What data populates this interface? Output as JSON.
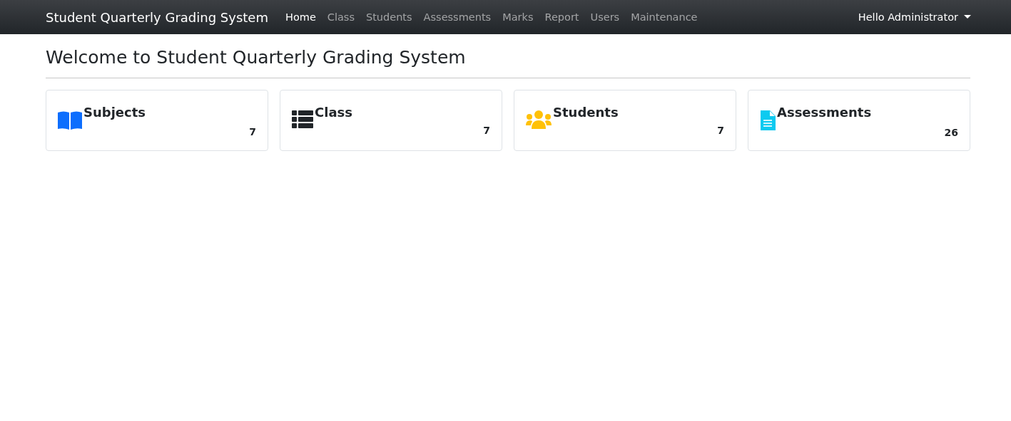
{
  "navbar": {
    "brand": "Student Quarterly Grading System",
    "items": [
      {
        "label": "Home",
        "selected": true
      },
      {
        "label": "Class",
        "selected": false
      },
      {
        "label": "Students",
        "selected": false
      },
      {
        "label": "Assessments",
        "selected": false
      },
      {
        "label": "Marks",
        "selected": false
      },
      {
        "label": "Report",
        "selected": false
      },
      {
        "label": "Users",
        "selected": false
      },
      {
        "label": "Maintenance",
        "selected": false
      }
    ],
    "user_menu": "Hello Administrator"
  },
  "heading": "Welcome to Student Quarterly Grading System",
  "cards": [
    {
      "kind": "book",
      "color": "#0d6efd",
      "title": "Subjects",
      "count": "7"
    },
    {
      "kind": "list",
      "color": "#212529",
      "title": "Class",
      "count": "7"
    },
    {
      "kind": "users",
      "color": "#ffc107",
      "title": "Students",
      "count": "7"
    },
    {
      "kind": "file",
      "color": "#0dcaf0",
      "title": "Assessments",
      "count": "26"
    }
  ]
}
